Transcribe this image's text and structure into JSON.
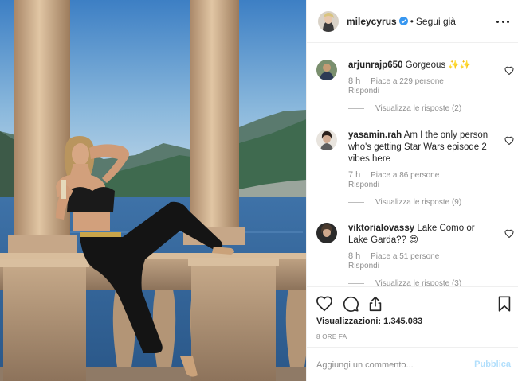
{
  "post": {
    "username": "mileycyrus",
    "follow_label": "Segui già",
    "separator": "•"
  },
  "comments": [
    {
      "user": "arjunrajp650",
      "text": "Gorgeous",
      "emoji": "✨✨",
      "time": "8 h",
      "likes": "Piace a 229 persone",
      "reply": "Rispondi",
      "view_replies": "Visualizza le risposte (2)"
    },
    {
      "user": "yasamin.rah",
      "text": "Am I the only person who's getting Star Wars episode 2 vibes here",
      "time": "7 h",
      "likes": "Piace a 86 persone",
      "reply": "Rispondi",
      "view_replies": "Visualizza le risposte (9)"
    },
    {
      "user": "viktorialovassy",
      "text": "Lake Como or Lake Garda??",
      "emoji": "😍",
      "time": "8 h",
      "likes": "Piace a 51 persone",
      "reply": "Rispondi",
      "view_replies": "Visualizza le risposte (3)"
    }
  ],
  "actions": {
    "icons": [
      "heart-icon",
      "comment-icon",
      "share-icon",
      "bookmark-icon"
    ],
    "views": "Visualizzazioni: 1.345.083",
    "date": "8 ORE FA"
  },
  "composer": {
    "placeholder": "Aggiungi un commento...",
    "publish_label": "Pubblica"
  },
  "colors": {
    "verified": "#3897f0",
    "publish_disabled": "#b2dffc",
    "meta_text": "#8e8e8e"
  }
}
